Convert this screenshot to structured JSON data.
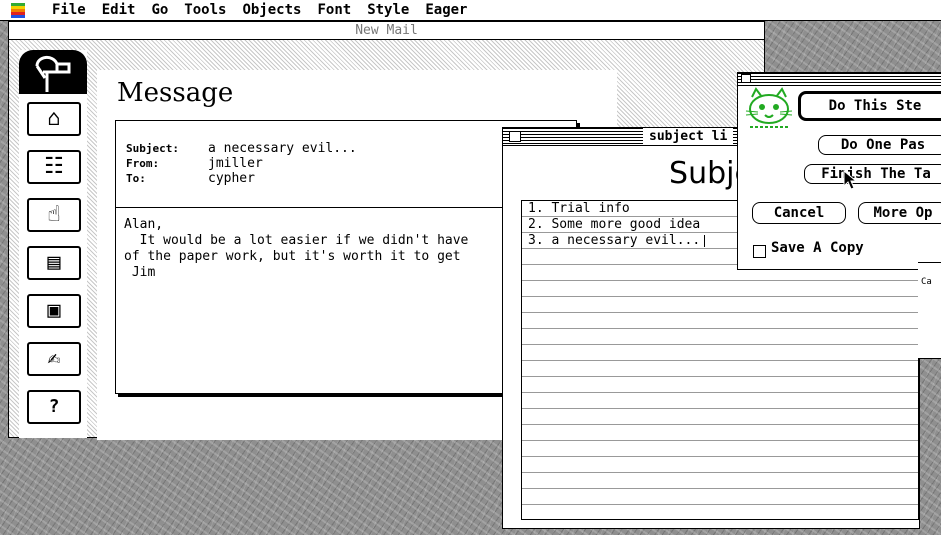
{
  "menubar": {
    "items": [
      "File",
      "Edit",
      "Go",
      "Tools",
      "Objects",
      "Font",
      "Style",
      "Eager"
    ]
  },
  "mail_window": {
    "title": "New Mail",
    "message_title": "Message",
    "subject_label": "Subject:",
    "subject_value": "a necessary evil...",
    "from_label": "From:",
    "from_value": "jmiller",
    "to_label": "To:",
    "to_value": "cypher",
    "body": "Alan,\n  It would be a lot easier if we didn't have\nof the paper work, but it's worth it to get\n Jim",
    "help_label": "?"
  },
  "subject_window": {
    "title": "subject li",
    "big_title": "Subje",
    "items": [
      "1. Trial info",
      "2. Some more good idea",
      "3. a necessary evil..."
    ]
  },
  "dialog": {
    "buttons": {
      "do_this_step": "Do This Ste",
      "do_one_pass": "Do One Pas",
      "finish_task": "Finish The Ta",
      "cancel": "Cancel",
      "more_options": "More Op"
    },
    "save_copy": "Save A Copy"
  },
  "right_panel": {
    "text": "Ca"
  },
  "colors": {
    "desktop": "#8f8f8f",
    "eager_cat": "#22aa22"
  }
}
